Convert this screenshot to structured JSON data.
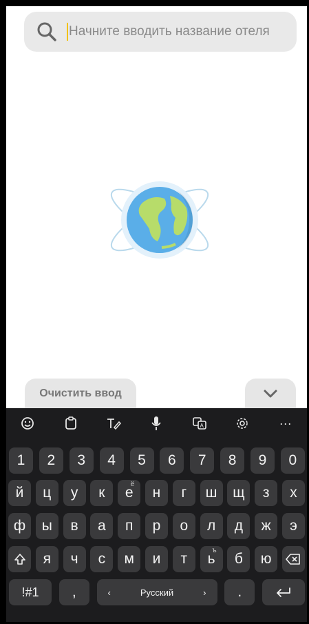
{
  "search": {
    "placeholder": "Начните вводить название отеля",
    "icon": "search-icon"
  },
  "illustration": {
    "icon": "globe-icon"
  },
  "actions": {
    "clear_label": "Очистить ввод",
    "collapse_icon": "chevron-down-icon"
  },
  "keyboard": {
    "toolbar_icons": [
      "emoji-icon",
      "clipboard-icon",
      "handwriting-icon",
      "microphone-icon",
      "translate-icon",
      "settings-icon",
      "more-icon"
    ],
    "more_label": "···",
    "numbers": [
      "1",
      "2",
      "3",
      "4",
      "5",
      "6",
      "7",
      "8",
      "9",
      "0"
    ],
    "row1": [
      "й",
      "ц",
      "у",
      "к",
      "е",
      "н",
      "г",
      "ш",
      "щ",
      "з",
      "х"
    ],
    "row1_sup_e": "ё",
    "row2": [
      "ф",
      "ы",
      "в",
      "а",
      "п",
      "р",
      "о",
      "л",
      "д",
      "ж",
      "э"
    ],
    "row3": [
      "я",
      "ч",
      "с",
      "м",
      "и",
      "т",
      "ь",
      "б",
      "ю"
    ],
    "row3_sup_soft": "ъ",
    "symbols_label": "!#1",
    "comma_label": ",",
    "space_label": "Русский",
    "space_left": "‹",
    "space_right": "›",
    "dot_label": "."
  },
  "colors": {
    "keyboard_bg": "#1c1c1e",
    "key_bg": "#3a3a3c",
    "search_bg": "#e9e9e9",
    "caret": "#f2c200"
  }
}
